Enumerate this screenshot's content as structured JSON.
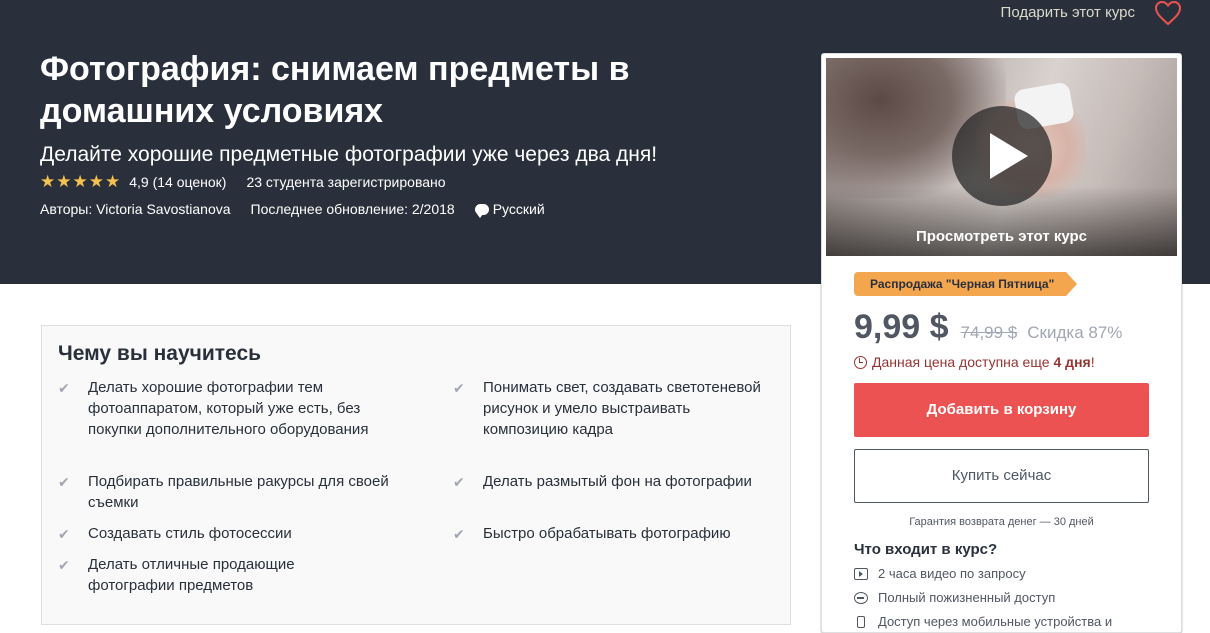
{
  "header": {
    "gift_label": "Подарить этот курс",
    "wishlist_icon": "heart-icon"
  },
  "course": {
    "title": "Фотография: снимаем предметы в домашних условиях",
    "subtitle": "Делайте хорошие предметные фотографии уже через два дня!",
    "rating_stars": 5,
    "rating_text": "4,9 (14 оценок)",
    "enrolled_text": "23 студента зарегистрировано",
    "authors_text": "Авторы: Victoria Savostianova",
    "updated_text": "Последнее обновление: 2/2018",
    "language": "Русский"
  },
  "learn": {
    "title": "Чему вы научитесь",
    "items": [
      "Делать хорошие фотографии тем фотоаппаратом, который уже есть, без покупки дополнительного оборудования",
      "Понимать свет, создавать светотеневой рисунок и умело выстраивать композицию кадра",
      "Подбирать правильные ракурсы для своей съемки",
      "Делать размытый фон на фотографии",
      "Создавать стиль фотосессии",
      "Быстро обрабатывать фотографию",
      "Делать отличные продающие фотографии предметов"
    ]
  },
  "sidebar": {
    "preview_label": "Просмотреть этот курс",
    "sale_badge": "Распродажа \"Черная Пятница\"",
    "price": "9,99 $",
    "old_price": "74,99 $",
    "discount": "Скидка 87%",
    "timer_prefix": "Данная цена доступна еще",
    "timer_value": "4 дня",
    "timer_suffix": "!",
    "add_to_cart": "Добавить в корзину",
    "buy_now": "Купить сейчас",
    "guarantee": "Гарантия возврата денег — 30 дней",
    "includes_title": "Что входит в курс?",
    "includes": [
      {
        "icon": "video-icon",
        "text": "2 часа видео по запросу"
      },
      {
        "icon": "infinity-icon",
        "text": "Полный пожизненный доступ"
      },
      {
        "icon": "mobile-icon",
        "text": "Доступ через мобильные устройства и"
      }
    ]
  },
  "colors": {
    "hero_bg": "#29303b",
    "star": "#f4c150",
    "cart_button": "#ec5252",
    "sale_badge": "#f4a64f",
    "timer_text": "#963434"
  }
}
